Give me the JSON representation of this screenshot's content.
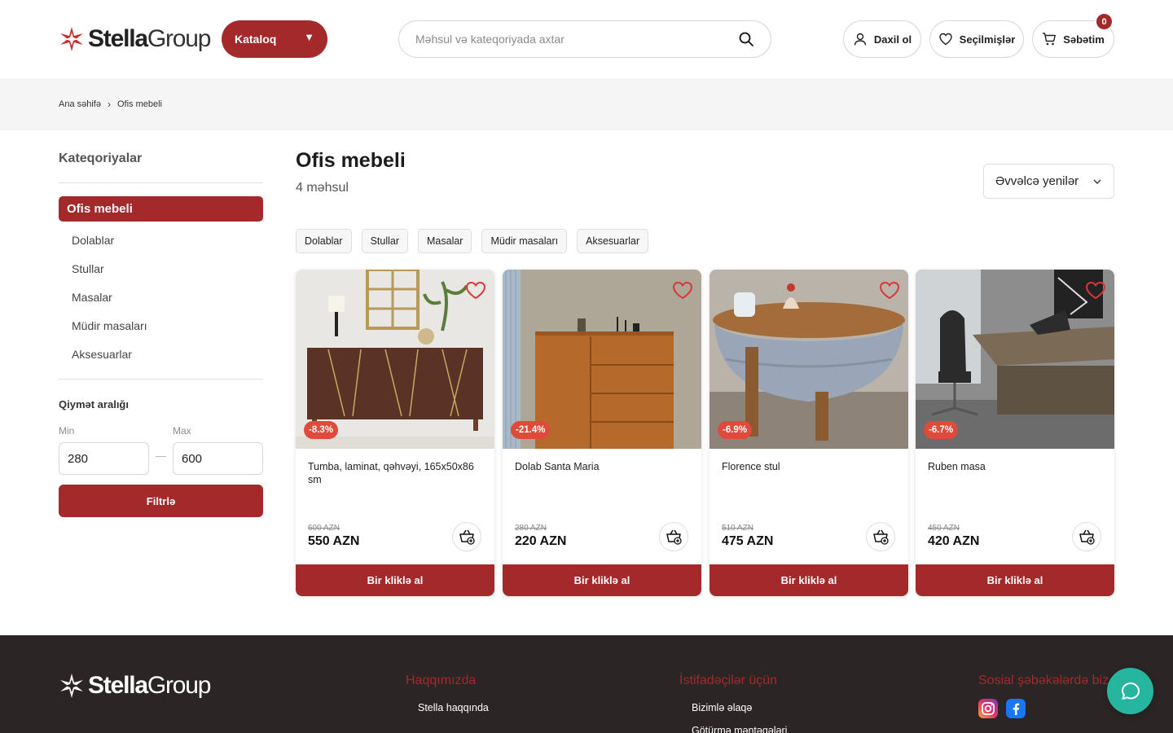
{
  "brand": {
    "name_bold": "Stella",
    "name_light": "Group"
  },
  "header": {
    "catalog_label": "Kataloq",
    "search_placeholder": "Məhsul və kateqoriyada axtar",
    "login_label": "Daxil ol",
    "favorites_label": "Seçilmişlər",
    "cart_label": "Səbətim",
    "cart_count": "0"
  },
  "breadcrumb": {
    "home": "Ana səhifə",
    "current": "Ofis mebeli"
  },
  "sidebar": {
    "title": "Kateqoriyalar",
    "active": "Ofis mebeli",
    "items": [
      "Dolablar",
      "Stullar",
      "Masalar",
      "Müdir masaları",
      "Aksesuarlar"
    ],
    "price_title": "Qiymət aralığı",
    "min_label": "Min",
    "max_label": "Max",
    "min_value": "280",
    "max_value": "600",
    "filter_label": "Filtrlə"
  },
  "main": {
    "title": "Ofis mebeli",
    "count": "4 məhsul",
    "sort_label": "Əvvəlcə yenilər",
    "chips": [
      "Dolablar",
      "Stullar",
      "Masalar",
      "Müdir masaları",
      "Aksesuarlar"
    ]
  },
  "products": [
    {
      "name": "Tumba, laminat, qəhvəyi, 165x50x86 sm",
      "discount": "-8.3%",
      "old_price": "600 AZN",
      "price": "550 AZN",
      "buy_label": "Bir kliklə al"
    },
    {
      "name": "Dolab Santa Maria",
      "discount": "-21.4%",
      "old_price": "280 AZN",
      "price": "220 AZN",
      "buy_label": "Bir kliklə al"
    },
    {
      "name": "Florence stul",
      "discount": "-6.9%",
      "old_price": "510 AZN",
      "price": "475 AZN",
      "buy_label": "Bir kliklə al"
    },
    {
      "name": "Ruben masa",
      "discount": "-6.7%",
      "old_price": "450 AZN",
      "price": "420 AZN",
      "buy_label": "Bir kliklə al"
    }
  ],
  "footer": {
    "col1_title": "Haqqımızda",
    "col1_link": "Stella haqqında",
    "col2_title": "İstifadəçilər üçün",
    "col2_link1": "Bizimlə əlaqə",
    "col2_link2": "Götürmə məntəqələri",
    "col3_title": "Sosial şəbəkələrdə biz"
  },
  "colors": {
    "brand": "#a3292b",
    "discount": "#e04a3a",
    "footer_bg": "#2b2625",
    "chat": "#26b6a0"
  }
}
